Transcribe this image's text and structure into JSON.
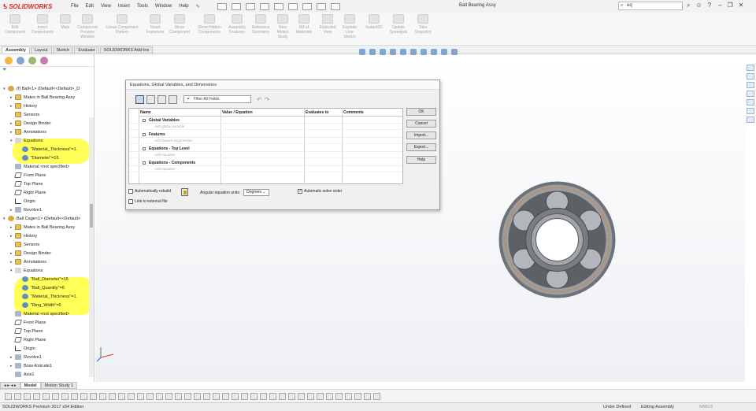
{
  "app": {
    "brand": "SOLIDWORKS",
    "menu": [
      "File",
      "Edit",
      "View",
      "Insert",
      "Tools",
      "Window",
      "Help"
    ],
    "document_title": "Ball Bearing Assy",
    "search_value": "eq"
  },
  "command_manager": [
    "Edit Component",
    "Insert Components",
    "Mate",
    "Component Preview Window",
    "Linear Component Pattern",
    "Smart Fasteners",
    "Move Component",
    "Show Hidden Components",
    "Assembly Features",
    "Reference Geometry",
    "New Motion Study",
    "Bill of Materials",
    "Exploded View",
    "Explode Line Sketch",
    "Instant3D",
    "Update Speedpak",
    "Take Snapshot"
  ],
  "tabs": [
    "Assembly",
    "Layout",
    "Sketch",
    "Evaluate",
    "SOLIDWORKS Add-Ins"
  ],
  "tree": [
    {
      "text": "(f) Ball<1> (Default<<Default>_D",
      "indent": 0,
      "icon": "part",
      "twisty": "▾"
    },
    {
      "text": "Mates in Ball Bearing Assy",
      "indent": 1,
      "icon": "folder",
      "twisty": "▸"
    },
    {
      "text": "History",
      "indent": 1,
      "icon": "folder",
      "twisty": "▸"
    },
    {
      "text": "Sensors",
      "indent": 1,
      "icon": "folder",
      "twisty": ""
    },
    {
      "text": "Design Binder",
      "indent": 1,
      "icon": "folder",
      "twisty": "▸"
    },
    {
      "text": "Annotations",
      "indent": 1,
      "icon": "folder",
      "twisty": "▸"
    },
    {
      "text": "Equations",
      "indent": 1,
      "icon": "sigma",
      "twisty": "▾"
    },
    {
      "text": "\"Material_Thickness\"=1.",
      "indent": 2,
      "icon": "eq",
      "twisty": ""
    },
    {
      "text": "\"Diameter\"=15",
      "indent": 2,
      "icon": "eq",
      "twisty": ""
    },
    {
      "text": "Material <not specified>",
      "indent": 1,
      "icon": "feat",
      "twisty": ""
    },
    {
      "text": "Front Plane",
      "indent": 1,
      "icon": "plane",
      "twisty": ""
    },
    {
      "text": "Top Plane",
      "indent": 1,
      "icon": "plane",
      "twisty": ""
    },
    {
      "text": "Right Plane",
      "indent": 1,
      "icon": "plane",
      "twisty": ""
    },
    {
      "text": "Origin",
      "indent": 1,
      "icon": "origin",
      "twisty": ""
    },
    {
      "text": "Revolve1",
      "indent": 1,
      "icon": "feat",
      "twisty": "▸"
    },
    {
      "text": "Ball Cage<1> (Default<<Default>",
      "indent": 0,
      "icon": "part",
      "twisty": "▾"
    },
    {
      "text": "Mates in Ball Bearing Assy",
      "indent": 1,
      "icon": "folder",
      "twisty": "▸"
    },
    {
      "text": "History",
      "indent": 1,
      "icon": "folder",
      "twisty": "▸"
    },
    {
      "text": "Sensors",
      "indent": 1,
      "icon": "folder",
      "twisty": ""
    },
    {
      "text": "Design Binder",
      "indent": 1,
      "icon": "folder",
      "twisty": "▸"
    },
    {
      "text": "Annotations",
      "indent": 1,
      "icon": "folder",
      "twisty": "▸"
    },
    {
      "text": "Equations",
      "indent": 1,
      "icon": "sigma",
      "twisty": "▾"
    },
    {
      "text": "\"Ball_Diameter\"=15",
      "indent": 2,
      "icon": "eq",
      "twisty": ""
    },
    {
      "text": "\"Ball_Quantity\"=6",
      "indent": 2,
      "icon": "eq",
      "twisty": ""
    },
    {
      "text": "\"Material_Thickness\"=1.",
      "indent": 2,
      "icon": "eq",
      "twisty": ""
    },
    {
      "text": "\"Ring_Width\"=5",
      "indent": 2,
      "icon": "eq",
      "twisty": ""
    },
    {
      "text": "Material <not specified>",
      "indent": 1,
      "icon": "feat",
      "twisty": ""
    },
    {
      "text": "Front Plane",
      "indent": 1,
      "icon": "plane",
      "twisty": ""
    },
    {
      "text": "Top Plane",
      "indent": 1,
      "icon": "plane",
      "twisty": ""
    },
    {
      "text": "Right Plane",
      "indent": 1,
      "icon": "plane",
      "twisty": ""
    },
    {
      "text": "Origin",
      "indent": 1,
      "icon": "origin",
      "twisty": ""
    },
    {
      "text": "Revolve1",
      "indent": 1,
      "icon": "feat",
      "twisty": "▸"
    },
    {
      "text": "Boss-Extrude1",
      "indent": 1,
      "icon": "feat",
      "twisty": "▸"
    },
    {
      "text": "Axis1",
      "indent": 1,
      "icon": "feat",
      "twisty": ""
    }
  ],
  "dialog": {
    "title": "Equations, Global Variables, and Dimensions",
    "filter_placeholder": "Filter All Fields",
    "columns": [
      "Name",
      "Value / Equation",
      "Evaluates to",
      "Comments"
    ],
    "sections": [
      {
        "title": "Global Variables",
        "add": "Add global variable"
      },
      {
        "title": "Features",
        "add": "Add feature suppression"
      },
      {
        "title": "Equations - Top Level",
        "add": "Add equation"
      },
      {
        "title": "Equations - Components",
        "add": "Add equation"
      }
    ],
    "buttons": [
      "OK",
      "Cancel",
      "Import...",
      "Export...",
      "Help"
    ],
    "auto_rebuild_label": "Automatically rebuild",
    "angular_label": "Angular equation units:",
    "angular_value": "Degrees",
    "auto_solve_label": "Automatic solve order",
    "link_external_label": "Link to external file",
    "auto_solve_checked": "✓"
  },
  "bottom_tabs": [
    "Model",
    "Motion Study 1"
  ],
  "status": {
    "edition": "SOLIDWORKS Premium 2017 x64 Edition",
    "state": "Under Defined",
    "mode": "Editing Assembly",
    "units": "MMGS"
  },
  "colors": {
    "highlight": "#ffff3a",
    "brand": "#d52b1e",
    "bearing_gray": "#8e9196",
    "cage_orange": "#d9832b"
  }
}
